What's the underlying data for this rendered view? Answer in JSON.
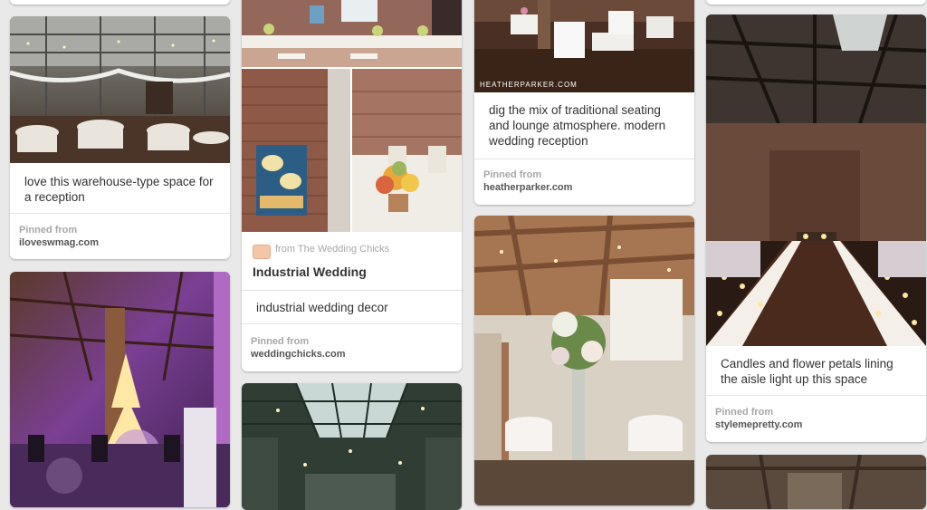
{
  "pins": {
    "warehouse": {
      "description": "love this warehouse-type space for a reception",
      "pinned_from_label": "Pinned from",
      "source": "iloveswmag.com"
    },
    "industrial": {
      "from_board": "from The Wedding Chicks",
      "board_title": "Industrial Wedding",
      "description": "industrial wedding decor",
      "pinned_from_label": "Pinned from",
      "source": "weddingchicks.com"
    },
    "traditional": {
      "watermark": "HEATHERPARKER.COM",
      "description": "dig the mix of traditional seating and lounge atmosphere. modern wedding reception",
      "pinned_from_label": "Pinned from",
      "source": "heatherparker.com"
    },
    "candles": {
      "description": "Candles and flower petals lining the aisle light up this space",
      "pinned_from_label": "Pinned from",
      "source": "stylemepretty.com"
    }
  },
  "image_subjects": [
    "warehouse-reception-photo",
    "brick-loft-table-photo",
    "mural-poster-photo",
    "flower-centerpiece-photo",
    "lounge-seating-photo",
    "purple-chandelier-hall-photo",
    "glass-roof-hall-photo",
    "wood-beam-reception-photo",
    "candlelit-aisle-photo",
    "wood-rafter-hall-photo"
  ]
}
